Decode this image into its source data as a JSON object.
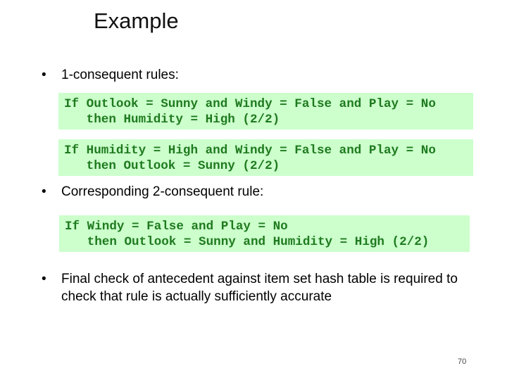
{
  "title": "Example",
  "bullets": [
    {
      "text": "1-consequent rules:"
    },
    {
      "text": "Corresponding 2-consequent rule:"
    },
    {
      "text": "Final check of antecedent against item set hash table is required to check that rule is actually sufficiently accurate"
    }
  ],
  "rules": [
    {
      "line1": "If Outlook = Sunny and Windy = False and Play = No",
      "line2": "   then Humidity = High (2/2)"
    },
    {
      "line1": "If Humidity = High and Windy = False and Play = No",
      "line2": "   then Outlook = Sunny (2/2)"
    },
    {
      "line1": "If Windy = False and Play = No",
      "line2": "   then Outlook = Sunny and Humidity = High (2/2)"
    }
  ],
  "page_number": "70",
  "colors": {
    "box_bg": "#ccffcc",
    "rule_text": "#1f7a1f"
  }
}
